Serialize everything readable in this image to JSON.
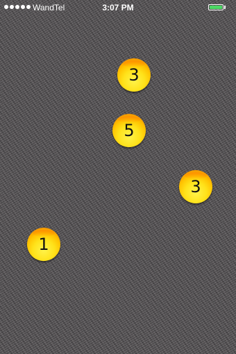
{
  "status_bar": {
    "carrier": "WandTel",
    "time": "3:07 PM",
    "signal_bars": 5,
    "battery_color": "#4cd964"
  },
  "coins": [
    {
      "label": "3"
    },
    {
      "label": "5"
    },
    {
      "label": "3"
    },
    {
      "label": "1"
    }
  ],
  "colors": {
    "background": "#5f5c5e",
    "coin_center": "#fff34a",
    "coin_edge": "#f08a00"
  }
}
